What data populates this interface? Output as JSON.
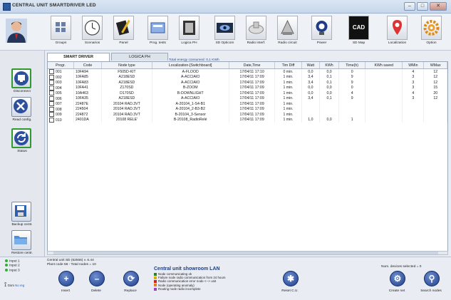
{
  "window": {
    "title": "CENTRAL UNIT SMARTDRIVER LED",
    "controls": [
      "–",
      "□",
      "✕"
    ]
  },
  "toolbar": {
    "buttons": [
      {
        "label": "Groups",
        "icon": "groups-icon"
      },
      {
        "label": "Scenarios",
        "icon": "clock-icon"
      },
      {
        "label": "Panel",
        "icon": "panel-icon"
      },
      {
        "label": "Prog. tests",
        "icon": "prog-tests-icon"
      },
      {
        "label": "Logica PH",
        "icon": "logica-ph-icon"
      },
      {
        "label": "SD Opticom",
        "icon": "eye-icon"
      },
      {
        "label": "Radio interf.",
        "icon": "radio-interface-icon"
      },
      {
        "label": "Radio circuit",
        "icon": "radio-circuit-icon"
      },
      {
        "label": "Power",
        "icon": "bulb-icon"
      },
      {
        "label": "SD Map",
        "icon": "cad-icon"
      },
      {
        "label": "Localization",
        "icon": "map-pin-icon"
      },
      {
        "label": "Option",
        "icon": "gear-icon"
      }
    ],
    "cad_text": "CAD"
  },
  "left_panel": {
    "buttons": [
      {
        "label": "Disconnect",
        "icon": "monitor-icon"
      },
      {
        "label": "Read config.",
        "icon": "tools-icon"
      },
      {
        "label": "Status",
        "icon": "refresh-icon"
      },
      {
        "label": "Backup centr.",
        "icon": "floppy-icon"
      },
      {
        "label": "Restore centr.",
        "icon": "folder-icon"
      }
    ]
  },
  "tabs": [
    "SMART DRIVER",
    "LOGICA PH"
  ],
  "energy": "Total energy consumed:    0,1 KWh",
  "grid": {
    "columns": [
      "Progr.",
      "Code",
      "Node type",
      "Localization-[Switchboard]",
      "Date,Time",
      "Tim Diff",
      "Watt",
      "KWh",
      "Time(h)",
      "KWh saved",
      "WMin",
      "WMax"
    ],
    "rows": [
      [
        "001",
        "10FA94",
        "F505D-KIT",
        "A-FLOOD",
        "17/04/11 17:10",
        "0 min.",
        "0,0",
        "0,0",
        "0",
        "",
        "4",
        "12"
      ],
      [
        "002",
        "10FA85",
        "A218ESD",
        "A-ACCIAIO",
        "17/04/11 17:09",
        "1 min.",
        "3,4",
        "0,1",
        "9",
        "",
        "3",
        "12"
      ],
      [
        "003",
        "10FA83",
        "A218ESD",
        "A-ACCIAIO",
        "17/04/11 17:09",
        "1 min.",
        "3,4",
        "0,1",
        "9",
        "",
        "3",
        "12"
      ],
      [
        "004",
        "10FA41",
        "Z170SD",
        "B-ZOOM",
        "17/04/11 17:09",
        "1 min.",
        "0,0",
        "0,0",
        "0",
        "",
        "3",
        "15"
      ],
      [
        "005",
        "10A463",
        "D170SD",
        "B-DOWNLIGHT",
        "17/04/11 17:09",
        "1 min.",
        "0,0",
        "0,0",
        "4",
        "",
        "4",
        "20"
      ],
      [
        "006",
        "10FA35",
        "A218ESD",
        "A-ACCIAIO",
        "17/04/11 17:09",
        "1 min.",
        "3,4",
        "0,1",
        "9",
        "",
        "3",
        "12"
      ],
      [
        "007",
        "22487E",
        "20104 RAD.3VT",
        "A-20104_1-S4-B1",
        "17/04/11 17:09",
        "1 min.",
        "",
        "",
        "",
        "",
        "",
        ""
      ],
      [
        "008",
        "224504",
        "20104 RAD.3VT",
        "A-20104_2-B3-B2",
        "17/04/11 17:09",
        "1 min.",
        "",
        "",
        "",
        "",
        "",
        ""
      ],
      [
        "009",
        "224872",
        "20104 RAD.3VT",
        "B-20104_3-Sensor",
        "17/04/11 17:09",
        "1 min.",
        "",
        "",
        "",
        "",
        "",
        ""
      ],
      [
        "010",
        "2401DA",
        "20108 RELE'",
        "B-20108_RadioRelé",
        "17/04/11 17:09",
        "1 min.",
        "1,0",
        "0,0",
        "1",
        "",
        "",
        ""
      ]
    ]
  },
  "status": {
    "inputs": [
      "Input 1",
      "Input 2",
      "Input 3"
    ],
    "cu_line1": "Central unit SD (62556)  v. 6.44",
    "cu_line2": "Plant code 56 - Total nodes = 10",
    "legend_title": "Central unit showroom  LAN",
    "legend": [
      {
        "text": "Node communicating ok",
        "color": "#2f7d2f"
      },
      {
        "text": "Failure node radio communication from 24 hours",
        "color": "#e0b000"
      },
      {
        "text": "Radio communication error node <--> unit",
        "color": "#d02020"
      },
      {
        "text": "Node (operating anomaly)",
        "color": "#e08020"
      },
      {
        "text": "Routing node radio incomplete",
        "color": "#a040c0"
      }
    ],
    "num_selected": "Num. devices selected = 0",
    "gsm_label": "Gsm",
    "gsm_status": "No reg"
  },
  "bottom_buttons": [
    {
      "label": "Insert",
      "glyph": "+"
    },
    {
      "label": "Delete",
      "glyph": "–"
    },
    {
      "label": "Replace",
      "glyph": "⟳"
    },
    {
      "label": "Reset C.U.",
      "glyph": "✱"
    },
    {
      "label": "Create net",
      "glyph": "⚙"
    },
    {
      "label": "Search nodes",
      "glyph": "⚲"
    }
  ]
}
